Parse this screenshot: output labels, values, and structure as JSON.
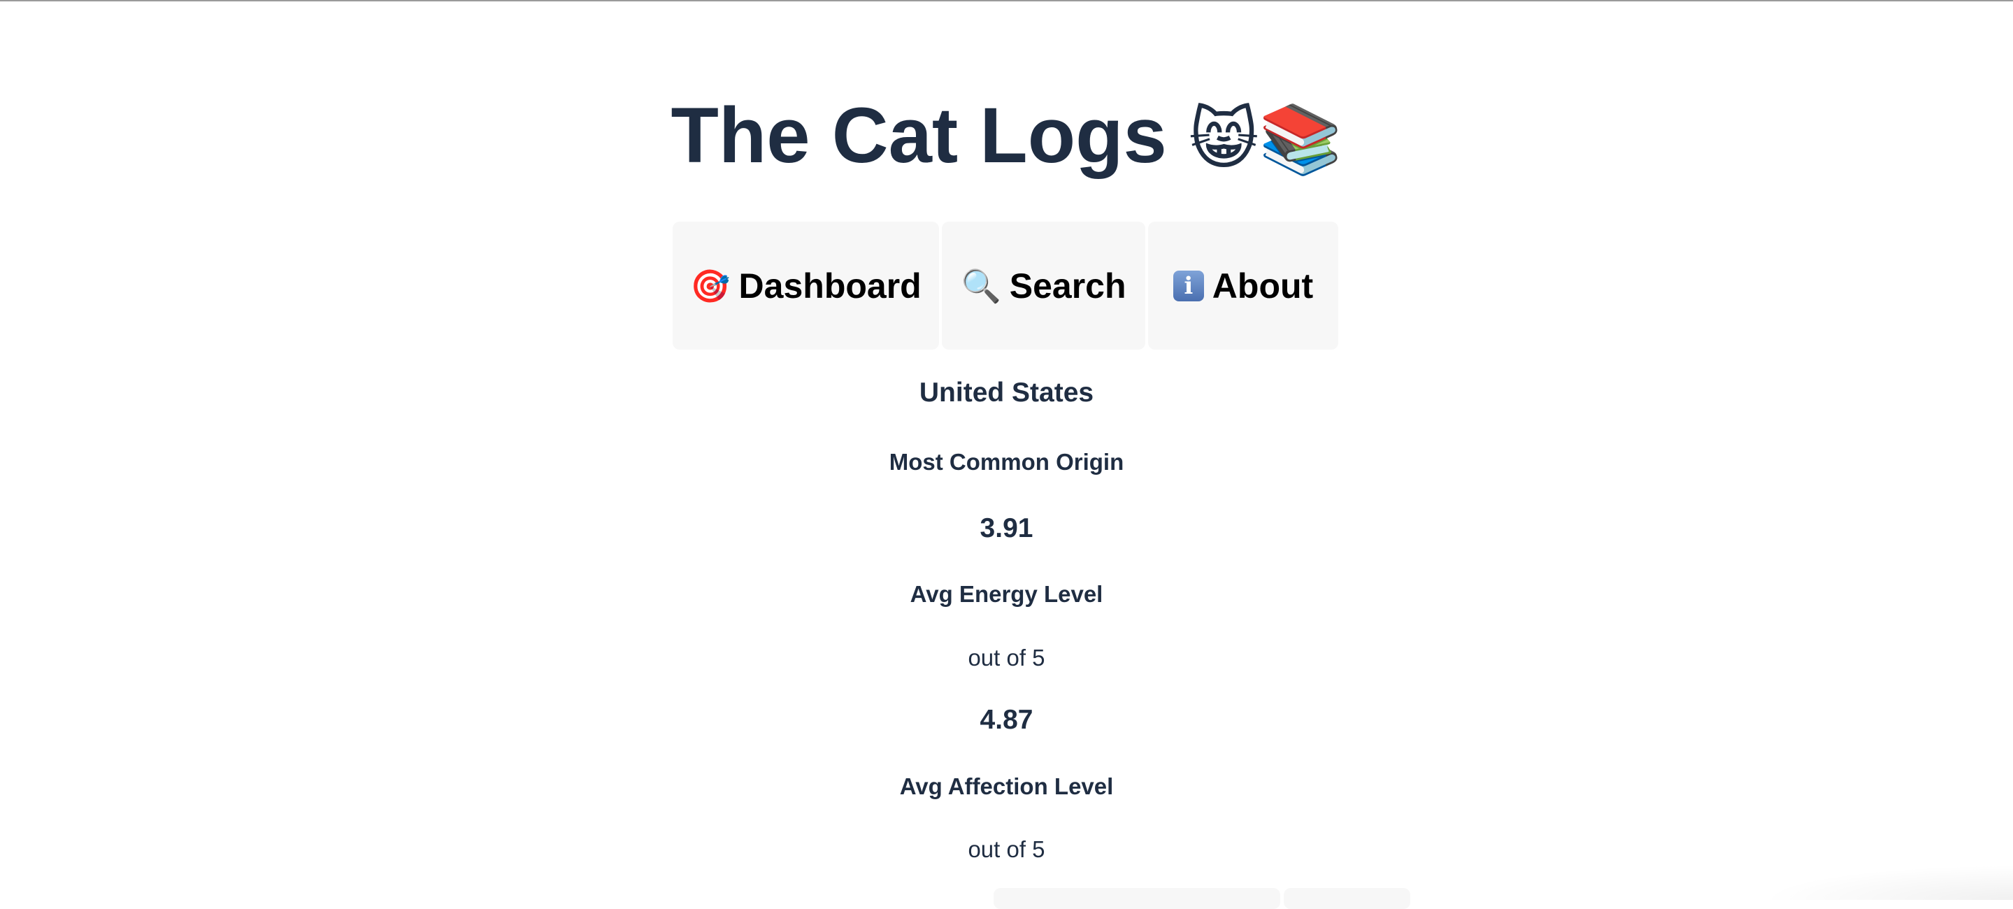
{
  "header": {
    "title": "The Cat Logs",
    "title_emojis": "😸📚"
  },
  "nav": {
    "tabs": [
      {
        "icon": "🎯",
        "icon_name": "target-icon",
        "label": "Dashboard"
      },
      {
        "icon": "🔍",
        "icon_name": "magnifier-icon",
        "label": "Search"
      },
      {
        "icon": "i",
        "icon_name": "info-icon",
        "label": "About"
      }
    ]
  },
  "stats": {
    "origin": {
      "value": "United States",
      "label": "Most Common Origin"
    },
    "energy": {
      "value": "3.91",
      "label": "Avg Energy Level",
      "unit": "out of 5"
    },
    "affection": {
      "value": "4.87",
      "label": "Avg Affection Level",
      "unit": "out of 5"
    }
  },
  "colors": {
    "text": "#1f2d42",
    "tab_background": "#f7f7f7",
    "tab_text": "#000000"
  }
}
